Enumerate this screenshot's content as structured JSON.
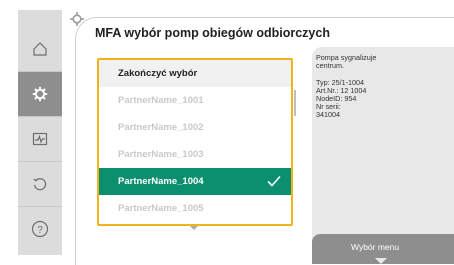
{
  "header": {
    "title": "MFA wybór pomp obiegów odbiorczych"
  },
  "list": {
    "items": [
      {
        "label": "Zakończyć wybór",
        "state": "normal"
      },
      {
        "label": "PartnerName_1001",
        "state": "disabled"
      },
      {
        "label": "PartnerName_1002",
        "state": "disabled"
      },
      {
        "label": "PartnerName_1003",
        "state": "disabled"
      },
      {
        "label": "PartnerName_1004",
        "state": "selected"
      },
      {
        "label": "PartnerName_1005",
        "state": "disabled"
      }
    ]
  },
  "info": {
    "line1": "Pompa sygnalizuje",
    "line2": "centrum.",
    "line3": "Typ: 25/1-1004",
    "line4": "Art.Nr.: 12 1004",
    "line5": "NodeID: 954",
    "line6": "Nr serii:",
    "line7": "341004"
  },
  "menu": {
    "label": "Wybór menu"
  },
  "colors": {
    "accent": "#0b8f6f",
    "focus": "#f2b21b",
    "sidebar": "#dcdcdc",
    "active": "#8e8e8e"
  }
}
